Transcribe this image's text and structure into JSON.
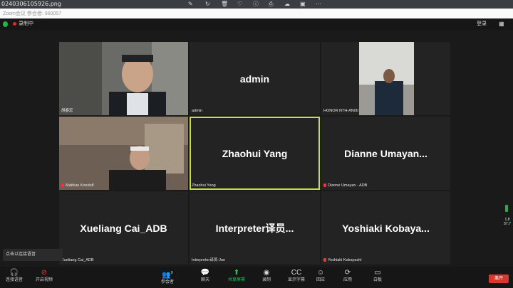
{
  "viewer": {
    "file_name": "0240306105926.png"
  },
  "window": {
    "title_hint": "Zoom会议 参会者: 960057"
  },
  "meeting": {
    "recording_label": "录制中",
    "signin_label": "登录",
    "view_icon": "grid-view-icon"
  },
  "tiles": [
    {
      "big": "",
      "name": "胡春宏",
      "muted": false
    },
    {
      "big": "admin",
      "name": "admin",
      "muted": false
    },
    {
      "big": "",
      "name": "HONOR NTH-AN00",
      "muted": false
    },
    {
      "big": "",
      "name": "Mathias Kondolf",
      "muted": true
    },
    {
      "big": "Zhaohui Yang",
      "name": "Zhaohui Yang",
      "muted": false
    },
    {
      "big": "Dianne  Umayan...",
      "name": "Dianne Umayan - ADB",
      "muted": true
    },
    {
      "big": "Xueliang Cai_ADB",
      "name": "Xueliang Cai_ADB",
      "muted": false
    },
    {
      "big": "Interpreter译员...",
      "name": "Interpreter译员-Joe",
      "muted": false
    },
    {
      "big": "Yoshiaki  Kobaya...",
      "name": "Yoshiaki Kobayashi",
      "muted": true
    }
  ],
  "side_stats": {
    "a": "1.8",
    "b": "57.7"
  },
  "popup": {
    "text": "点击以连接语音"
  },
  "toolbar": {
    "items": [
      {
        "label": "连接语音",
        "icon": "headphones-icon"
      },
      {
        "label": "开启视频",
        "icon": "video-off-icon"
      },
      {
        "label": "参会者",
        "icon": "participants-icon"
      },
      {
        "label": "聊天",
        "icon": "chat-icon"
      },
      {
        "label": "共享屏幕",
        "icon": "share-screen-icon"
      },
      {
        "label": "录制",
        "icon": "record-icon"
      },
      {
        "label": "显示字幕",
        "icon": "captions-icon"
      },
      {
        "label": "回应",
        "icon": "reactions-icon"
      },
      {
        "label": "应用",
        "icon": "apps-icon"
      },
      {
        "label": "白板",
        "icon": "whiteboard-icon"
      }
    ],
    "participants_count": "9",
    "leave_label": "离开"
  },
  "colors": {
    "share_green": "#23c45a",
    "speaker_outline": "#c7df3f",
    "leave_red": "#d8382f"
  }
}
